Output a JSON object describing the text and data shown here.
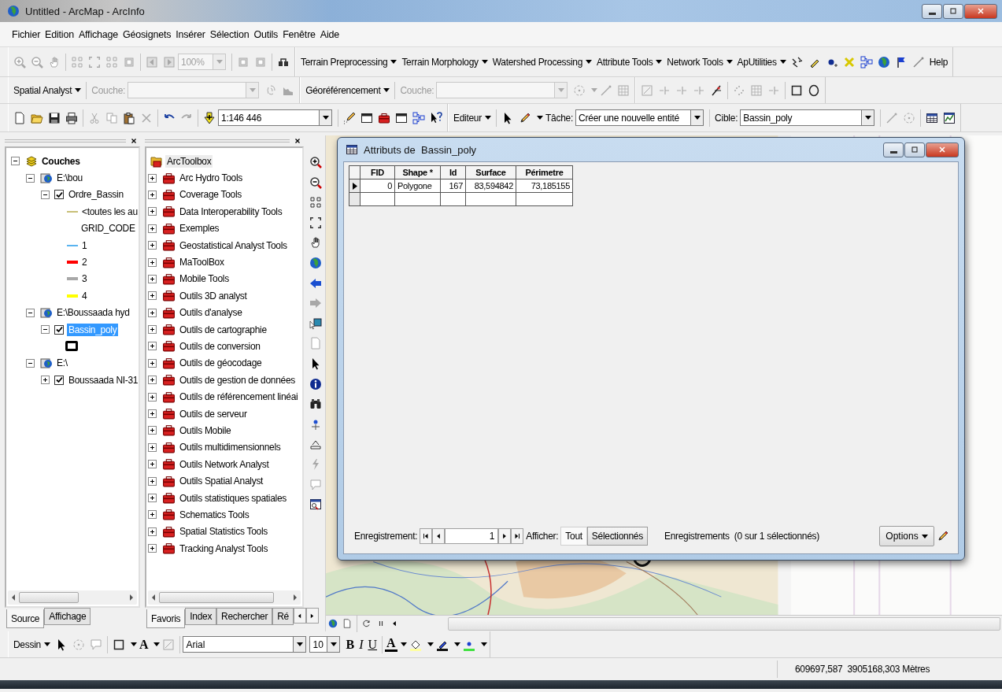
{
  "window": {
    "title": "Untitled - ArcMap - ArcInfo"
  },
  "menu": [
    "Fichier",
    "Edition",
    "Affichage",
    "Géosignets",
    "Insérer",
    "Sélection",
    "Outils",
    "Fenêtre",
    "Aide"
  ],
  "toolbar_1": {
    "zoom_combo": {
      "value": "100%",
      "disabled": true
    },
    "menus": [
      "Terrain Preprocessing",
      "Terrain Morphology",
      "Watershed Processing",
      "Attribute Tools",
      "Network Tools",
      "ApUtilities"
    ],
    "help": "Help"
  },
  "toolbar_2": {
    "spatial_analyst": {
      "menu": "Spatial Analyst",
      "layer_label": "Couche:",
      "disabled": true
    },
    "georeferencing": {
      "menu": "Géoréférencement",
      "layer_label": "Couche:",
      "disabled": true
    }
  },
  "toolbar_3": {
    "scale": "1:146 446",
    "editor": "Editeur",
    "task_label": "Tâche:",
    "task": "Créer une nouvelle entité",
    "target_label": "Cible:",
    "target": "Bassin_poly"
  },
  "table_of_contents": {
    "root": {
      "label": "Couches",
      "expanded": true,
      "children": [
        {
          "label": "E:\\bou",
          "expanded": true,
          "children": [
            {
              "label": "Ordre_Bassin",
              "checked": true,
              "selected": false,
              "expanded": true,
              "legend": [
                {
                  "kind": "thin-line",
                  "label": "<toutes les au",
                  "color": "#c8c078"
                },
                {
                  "kind": "heading",
                  "label": "GRID_CODE"
                },
                {
                  "kind": "thin-line",
                  "label": "1",
                  "color": "#5ab4f0"
                },
                {
                  "kind": "thick-line",
                  "label": "2",
                  "color": "#ff0000"
                },
                {
                  "kind": "thick-line",
                  "label": "3",
                  "color": "#a8a8a8"
                },
                {
                  "kind": "thick-line",
                  "label": "4",
                  "color": "#ffff00"
                }
              ]
            }
          ]
        },
        {
          "label": "E:\\Boussaada hyd",
          "expanded": true,
          "children": [
            {
              "label": "Bassin_poly",
              "checked": true,
              "selected": true,
              "expanded": true,
              "legend": [
                {
                  "kind": "polygon"
                }
              ]
            }
          ]
        },
        {
          "label": "E:\\",
          "expanded": true,
          "children": [
            {
              "label": "Boussaada NI-31",
              "checked": true,
              "selected": false,
              "expanded": false
            }
          ]
        }
      ]
    }
  },
  "toc_tabs": [
    {
      "label": "Source",
      "selected": true
    },
    {
      "label": "Affichage",
      "selected": false
    }
  ],
  "toolbox": {
    "root": {
      "label": "ArcToolbox",
      "children": [
        {
          "label": "Arc Hydro Tools",
          "expanded": false
        },
        {
          "label": "Coverage Tools",
          "expanded": false
        },
        {
          "label": "Data Interoperability Tools",
          "expanded": false
        },
        {
          "label": "Exemples",
          "expanded": false
        },
        {
          "label": "Geostatistical Analyst Tools",
          "expanded": false
        },
        {
          "label": "MaToolBox",
          "expanded": false
        },
        {
          "label": "Mobile Tools",
          "expanded": false
        },
        {
          "label": "Outils 3D analyst",
          "expanded": false
        },
        {
          "label": "Outils d'analyse",
          "expanded": false
        },
        {
          "label": "Outils de cartographie",
          "expanded": false
        },
        {
          "label": "Outils de conversion",
          "expanded": false
        },
        {
          "label": "Outils de géocodage",
          "expanded": false
        },
        {
          "label": "Outils de gestion de données",
          "expanded": false
        },
        {
          "label": "Outils de référencement linéai",
          "expanded": false
        },
        {
          "label": "Outils de serveur",
          "expanded": false
        },
        {
          "label": "Outils Mobile",
          "expanded": false
        },
        {
          "label": "Outils multidimensionnels",
          "expanded": false
        },
        {
          "label": "Outils Network Analyst",
          "expanded": false
        },
        {
          "label": "Outils Spatial Analyst",
          "expanded": false
        },
        {
          "label": "Outils statistiques spatiales",
          "expanded": false
        },
        {
          "label": "Schematics Tools",
          "expanded": false
        },
        {
          "label": "Spatial Statistics Tools",
          "expanded": false
        },
        {
          "label": "Tracking Analyst Tools",
          "expanded": false
        }
      ]
    }
  },
  "toolbox_tabs": [
    {
      "label": "Favoris",
      "selected": true
    },
    {
      "label": "Index",
      "selected": false
    },
    {
      "label": "Rechercher",
      "selected": false
    },
    {
      "label": "Ré",
      "selected": false
    }
  ],
  "attribute_window": {
    "title": "Attributs de  Bassin_poly",
    "columns": [
      "FID",
      "Shape *",
      "Id",
      "Surface",
      "Périmetre"
    ],
    "rows": [
      {
        "current": true,
        "cells": [
          "0",
          "Polygone",
          "167",
          "83,594842",
          "73,185155"
        ]
      }
    ],
    "footer": {
      "record_label": "Enregistrement:",
      "record": "1",
      "show_label": "Afficher:",
      "show_options": [
        {
          "label": "Tout",
          "selected": true
        },
        {
          "label": "Sélectionnés",
          "selected": false
        }
      ],
      "summary": "Enregistrements  (0 sur 1 sélectionnés)",
      "options": "Options"
    }
  },
  "draw_toolbar": {
    "menu": "Dessin",
    "text_tool": "A",
    "font": "Arial",
    "font_size": "10",
    "bold": "B",
    "italic": "I",
    "underline": "U",
    "font_color": "A"
  },
  "status_bar": {
    "coordinates": "609697,587  3905168,303 Mètres"
  }
}
